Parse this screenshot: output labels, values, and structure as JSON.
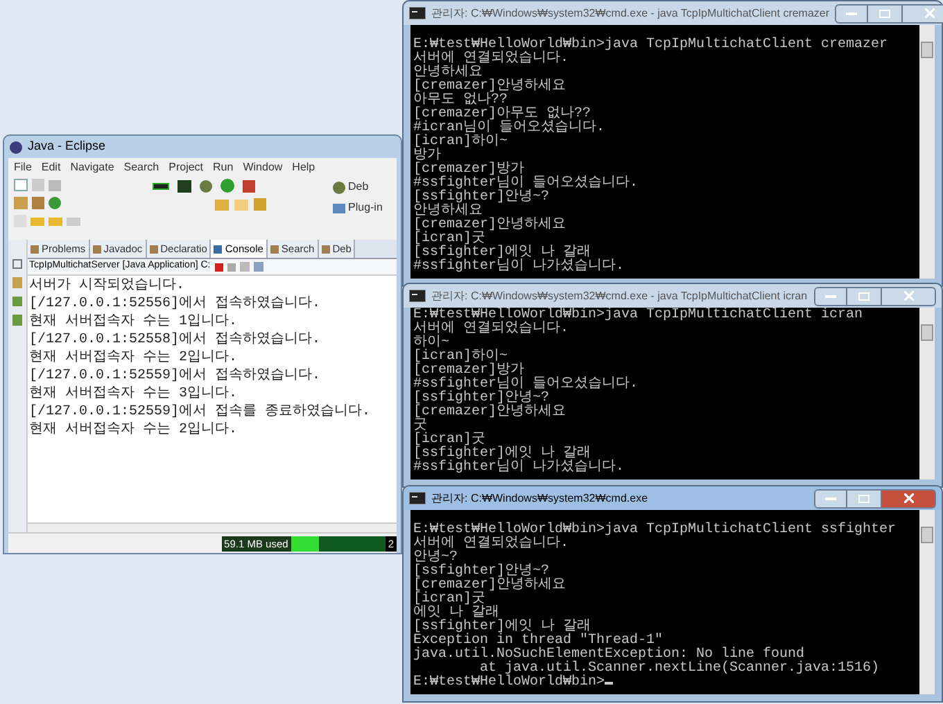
{
  "eclipse": {
    "title": "Java - Eclipse",
    "menu": [
      "File",
      "Edit",
      "Navigate",
      "Search",
      "Project",
      "Run",
      "Window",
      "Help"
    ],
    "toolbar_labels": [
      "Deb",
      "Plug-in"
    ],
    "tabs": [
      {
        "label": "Problems",
        "selected": false
      },
      {
        "label": "Javadoc",
        "selected": false
      },
      {
        "label": "Declaratio",
        "selected": false
      },
      {
        "label": "Console",
        "selected": true
      },
      {
        "label": "Search",
        "selected": false
      },
      {
        "label": "Deb",
        "selected": false
      }
    ],
    "console_header": "TcpIpMultichatServer [Java Application] C:",
    "console_lines": [
      "서버가 시작되었습니다.",
      "[/127.0.0.1:52556]에서 접속하였습니다.",
      "현재 서버접속자 수는 1입니다.",
      "[/127.0.0.1:52558]에서 접속하였습니다.",
      "현재 서버접속자 수는 2입니다.",
      "[/127.0.0.1:52559]에서 접속하였습니다.",
      "현재 서버접속자 수는 3입니다.",
      "[/127.0.0.1:52559]에서 접속를 종료하였습니다.",
      "현재 서버접속자 수는 2입니다."
    ],
    "status": {
      "memory": "59.1 MB used",
      "level": 0.3,
      "column_2": "2"
    }
  },
  "terminals": [
    {
      "title": "관리자: C:₩Windows₩system32₩cmd.exe - java  TcpIpMultichatClient cremazer",
      "active": false,
      "lines": [
        "E:₩test₩HelloWorld₩bin>java TcpIpMultichatClient cremazer",
        "서버에 연결되었습니다.",
        "안녕하세요",
        "[cremazer]안녕하세요",
        "아무도 없나??",
        "[cremazer]아무도 없나??",
        "#icran님이 들어오셨습니다.",
        "[icran]하이~",
        "방가",
        "[cremazer]방가",
        "#ssfighter님이 들어오셨습니다.",
        "[ssfighter]안녕~?",
        "안녕하세요",
        "[cremazer]안녕하세요",
        "[icran]굿",
        "[ssfighter]에잇 나 갈래",
        "#ssfighter님이 나가셨습니다."
      ]
    },
    {
      "title": "관리자: C:₩Windows₩system32₩cmd.exe - java  TcpIpMultichatClient icran",
      "active": false,
      "lines": [
        "E:₩test₩HelloWorld₩bin>java TcpIpMultichatClient icran",
        "서버에 연결되었습니다.",
        "하이~",
        "[icran]하이~",
        "[cremazer]방가",
        "#ssfighter님이 들어오셨습니다.",
        "[ssfighter]안녕~?",
        "[cremazer]안녕하세요",
        "굿",
        "[icran]굿",
        "[ssfighter]에잇 나 갈래",
        "#ssfighter님이 나가셨습니다."
      ]
    },
    {
      "title": "관리자: C:₩Windows₩system32₩cmd.exe",
      "active": true,
      "lines": [
        "E:₩test₩HelloWorld₩bin>java TcpIpMultichatClient ssfighter",
        "서버에 연결되었습니다.",
        "안녕~?",
        "[ssfighter]안녕~?",
        "[cremazer]안녕하세요",
        "[icran]굿",
        "에잇 나 갈래",
        "[ssfighter]에잇 나 갈래",
        "Exception in thread \"Thread-1\" java.util.NoSuchElementException: No line found",
        "        at java.util.Scanner.nextLine(Scanner.java:1516)",
        "E:₩test₩HelloWorld₩bin>"
      ]
    }
  ]
}
